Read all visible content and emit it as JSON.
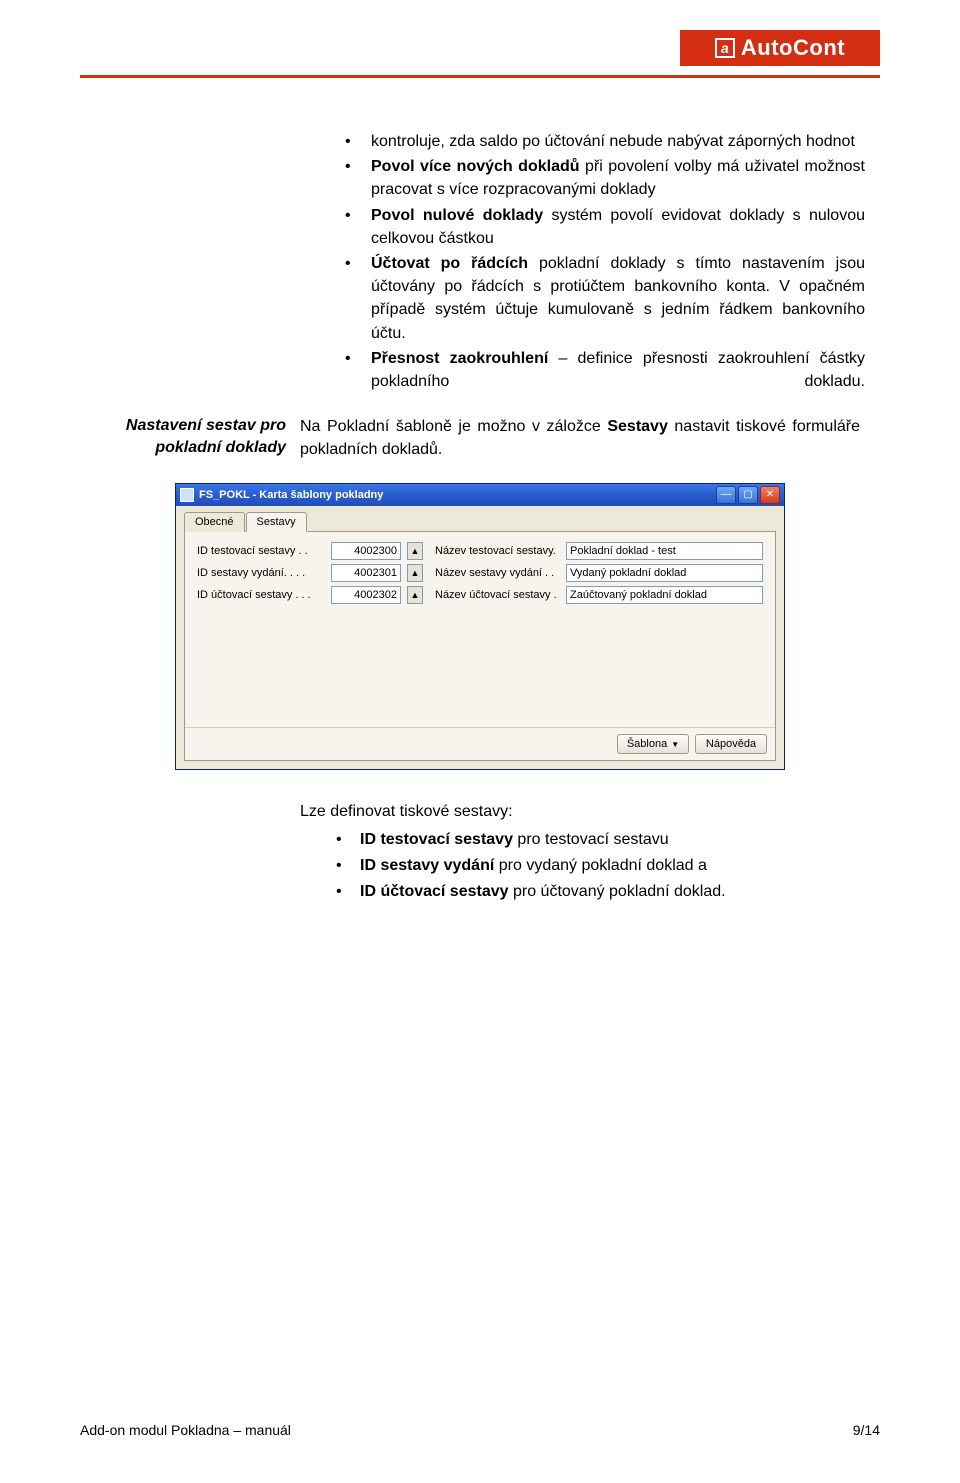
{
  "logo": {
    "text": "AutoCont",
    "icon_letter": "a"
  },
  "bullets_top": [
    {
      "plain": "kontroluje, zda saldo po účtování nebude nabývat záporných hodnot"
    },
    {
      "bold": "Povol více nových dokladů",
      "rest": " při povolení volby má uživatel možnost pracovat s více rozpracovanými doklady"
    },
    {
      "bold": "Povol nulové doklady",
      "rest": " systém povolí evidovat doklady s nulovou celkovou částkou"
    },
    {
      "bold": "Účtovat po řádcích",
      "rest": " pokladní doklady s tímto nastavením jsou účtovány po řádcích s protiúčtem bankovního konta. V opačném případě systém účtuje kumulovaně s jedním řádkem bankovního účtu."
    },
    {
      "bold": "Přesnost zaokrouhlení",
      "rest": " – definice přesnosti zaokrouhlení částky pokladního dokladu.",
      "justify_spread": true
    }
  ],
  "side_label": {
    "l1": "Nastavení sestav pro",
    "l2": "pokladní doklady"
  },
  "row2_text": {
    "pre": "Na Pokladní šabloně je možno v záložce ",
    "bold": "Sestavy",
    "post": " nastavit tiskové formuláře pokladních dokladů."
  },
  "window": {
    "title": "FS_POKL - Karta šablony pokladny",
    "tabs": [
      "Obecné",
      "Sestavy"
    ],
    "rows": [
      {
        "label": "ID testovací sestavy  .  .",
        "id": "4002300",
        "label2": "Název testovací sestavy.",
        "value": "Pokladní doklad - test"
      },
      {
        "label": "ID sestavy vydání.  .  .  .",
        "id": "4002301",
        "label2": "Název sestavy vydání .  .",
        "value": "Vydaný pokladní doklad"
      },
      {
        "label": "ID účtovací sestavy  .  .  .",
        "id": "4002302",
        "label2": "Název účtovací sestavy  .",
        "value": "Zaúčtovaný pokladní doklad"
      }
    ],
    "buttons": {
      "template": "Šablona",
      "help": "Nápověda"
    }
  },
  "bottom": {
    "intro": "Lze definovat tiskové sestavy:",
    "items": [
      {
        "bold": "ID testovací sestavy",
        "rest": " pro testovací sestavu"
      },
      {
        "bold": "ID sestavy vydání",
        "rest": " pro vydaný pokladní doklad a"
      },
      {
        "bold": "ID účtovací sestavy",
        "rest": " pro účtovaný pokladní doklad."
      }
    ]
  },
  "footer": {
    "left": "Add-on modul Pokladna – manuál",
    "right": "9/14"
  }
}
